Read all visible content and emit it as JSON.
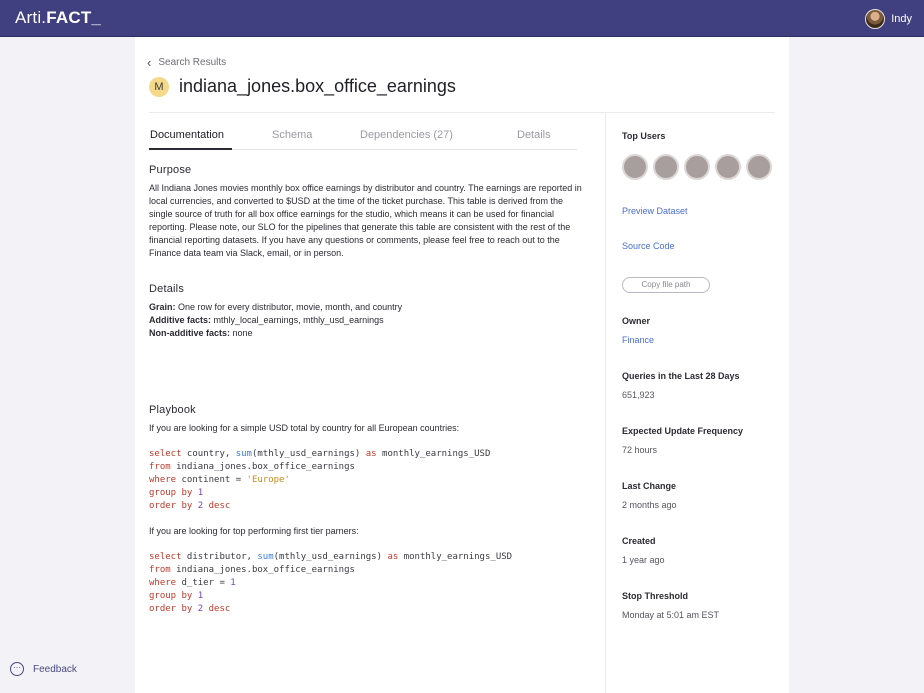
{
  "app": {
    "logo_prefix": "Arti.",
    "logo_brand": "FACT_",
    "user_name": "Indy",
    "feedback_label": "Feedback"
  },
  "breadcrumb": {
    "label": "Search Results"
  },
  "header": {
    "badge": "M",
    "title": "indiana_jones.box_office_earnings"
  },
  "tabs": [
    {
      "label": "Documentation",
      "active": true
    },
    {
      "label": "Schema"
    },
    {
      "label": "Dependencies (27)"
    },
    {
      "label": "Details"
    }
  ],
  "documentation": {
    "purpose_heading": "Purpose",
    "purpose_text": "All Indiana Jones movies monthly box office earnings by distributor and country. The earnings are reported in local currencies, and converted to $USD at the time of the ticket purchase. This table is derived from the single source of truth for all box office earnings for the studio, which means it can be used for financial reporting. Please note, our SLO for the pipelines that generate this table are consistent with the rest of the financial reporting datasets. If you have any questions or comments, please feel free to reach out to the Finance data team via Slack, email, or in person.",
    "details_heading": "Details",
    "grain_label": "Grain:",
    "grain_value": "One row for every distributor, movie, month, and country",
    "additive_label": "Additive facts:",
    "additive_value": "mthly_local_earnings, mthly_usd_earnings",
    "nonadditive_label": "Non-additive facts:",
    "nonadditive_value": "none",
    "playbook_heading": "Playbook",
    "playbook_intro_1": "If you are looking for a simple USD total by country for all European countries:",
    "playbook_intro_2": "If you are looking for top performing first tier parners:",
    "code1": {
      "l1_kw": "select",
      "l1_a": " country, ",
      "l1_fn": "sum",
      "l1_b": "(mthly_usd_earnings) ",
      "l1_kw2": "as",
      "l1_c": " monthly_earnings_USD",
      "l2_kw": "from",
      "l2_a": " indiana_jones.box_office_earnings",
      "l3_kw": "where",
      "l3_a": " continent = ",
      "l3_str": "'Europe'",
      "l4_kw": "group by",
      "l4_num": "1",
      "l5_kw": "order by",
      "l5_num": "2",
      "l5_kw2": "desc"
    },
    "code2": {
      "l1_kw": "select",
      "l1_a": " distributor, ",
      "l1_fn": "sum",
      "l1_b": "(mthly_usd_earnings) ",
      "l1_kw2": "as",
      "l1_c": " monthly_earnings_USD",
      "l2_kw": "from",
      "l2_a": " indiana_jones.box_office_earnings",
      "l3_kw": "where",
      "l3_a": " d_tier = ",
      "l3_num": "1",
      "l4_kw": "group by",
      "l4_num": "1",
      "l5_kw": "order by",
      "l5_num": "2",
      "l5_kw2": "desc"
    }
  },
  "sidebar": {
    "top_users_label": "Top Users",
    "preview_dataset": "Preview Dataset",
    "source_code": "Source Code",
    "copy_file_path": "Copy file path",
    "owner_label": "Owner",
    "owner_value": "Finance",
    "queries_label": "Queries in the Last 28 Days",
    "queries_value": "651,923",
    "update_freq_label": "Expected Update Frequency",
    "update_freq_value": "72 hours",
    "last_change_label": "Last Change",
    "last_change_value": "2 months ago",
    "created_label": "Created",
    "created_value": "1 year ago",
    "stop_label": "Stop Threshold",
    "stop_value": "Monday at 5:01 am EST"
  },
  "colors": {
    "topbar": "#403f7f",
    "link": "#4a6ed0",
    "keyword": "#c0392b",
    "function": "#3b7dd8",
    "string": "#c98b1a",
    "number": "#7a3fbf"
  }
}
